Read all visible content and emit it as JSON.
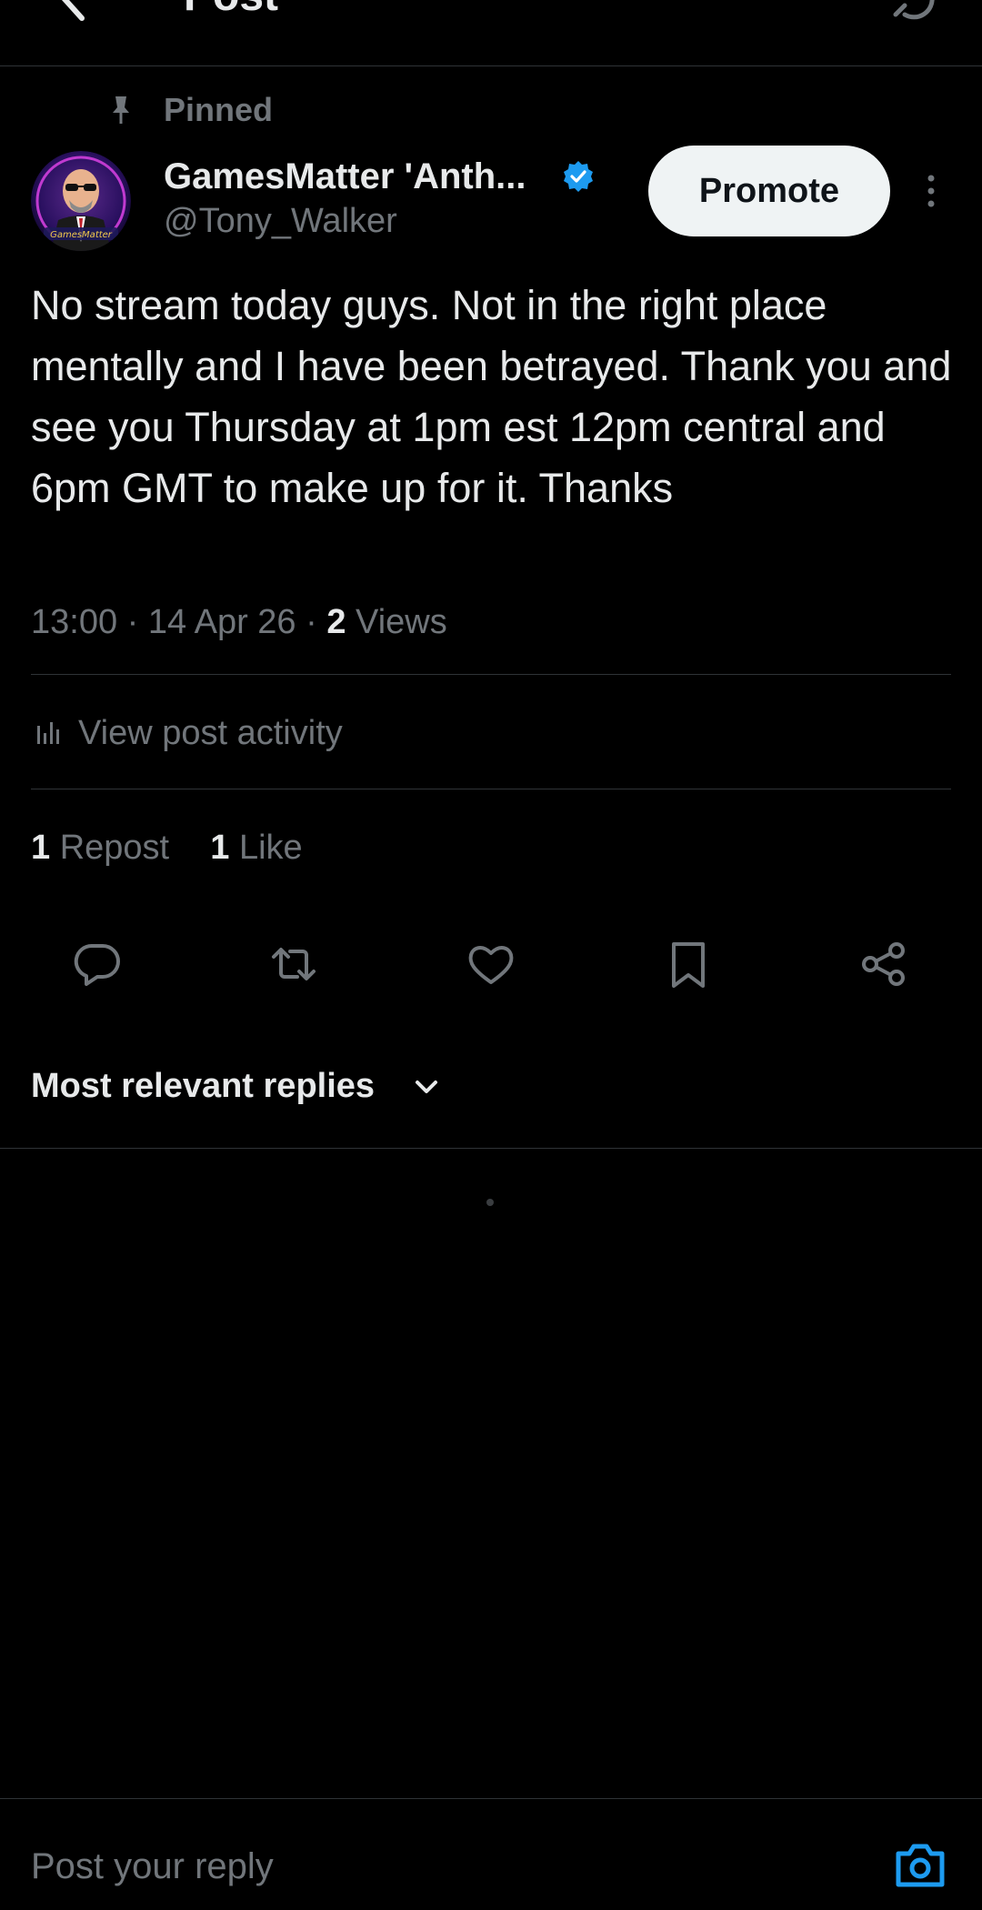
{
  "header": {
    "title": "Post"
  },
  "post": {
    "pinned_label": "Pinned",
    "author_name": "GamesMatter 'Anth...",
    "author_handle": "@Tony_Walker",
    "promote_label": "Promote",
    "text": "No stream today guys. Not in the right place mentally and I have been betrayed. Thank you and see you Thursday at 1pm est 12pm central and 6pm GMT to make up for it. Thanks",
    "time": "13:00",
    "date": "14 Apr 26",
    "views_count": "2",
    "views_label": "Views",
    "activity_label": "View post activity",
    "repost_count": "1",
    "repost_label": "Repost",
    "like_count": "1",
    "like_label": "Like"
  },
  "actions": {
    "icons": [
      "reply-icon",
      "repost-icon",
      "like-icon",
      "bookmark-icon",
      "share-icon"
    ]
  },
  "replies": {
    "sort_label": "Most relevant replies"
  },
  "composer": {
    "placeholder": "Post your reply"
  },
  "colors": {
    "background": "#000000",
    "text_primary": "#e7e9ea",
    "text_secondary": "#71767b",
    "divider": "#2f3336",
    "accent": "#1d9bf0",
    "button_bg": "#eff3f4"
  }
}
